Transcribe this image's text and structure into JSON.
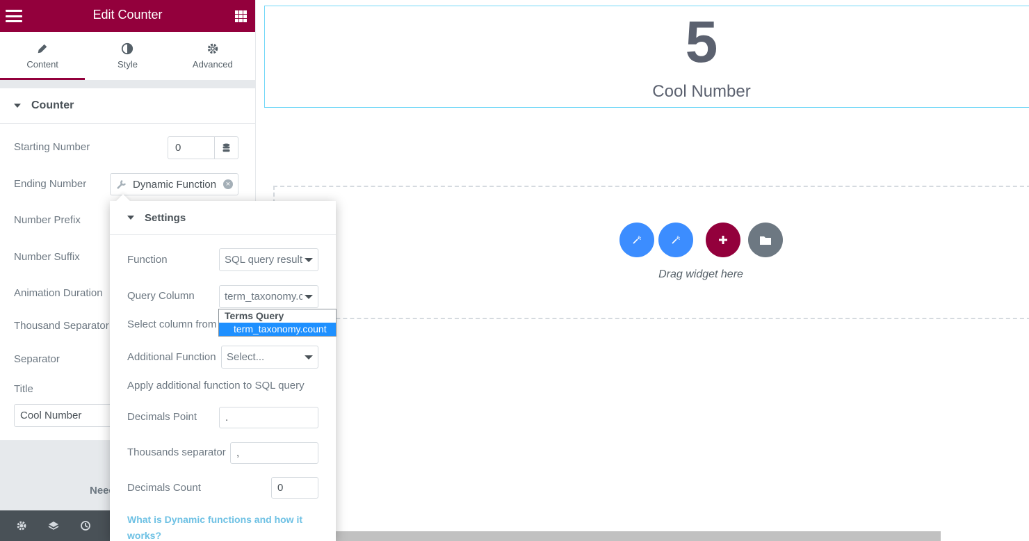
{
  "panel": {
    "title": "Edit Counter",
    "tabs": [
      {
        "label": "Content",
        "icon": "pencil-icon"
      },
      {
        "label": "Style",
        "icon": "half-circle-icon"
      },
      {
        "label": "Advanced",
        "icon": "gear-icon"
      }
    ],
    "section_title": "Counter",
    "fields": {
      "starting_number": {
        "label": "Starting Number",
        "value": "0"
      },
      "ending_number": {
        "label": "Ending Number",
        "dynamic_tag": "Dynamic Function"
      },
      "number_prefix": {
        "label": "Number Prefix"
      },
      "number_suffix": {
        "label": "Number Suffix"
      },
      "animation_duration": {
        "label": "Animation Duration"
      },
      "thousand_separator": {
        "label": "Thousand Separator"
      },
      "separator": {
        "label": "Separator"
      },
      "title": {
        "label": "Title",
        "value": "Cool Number"
      }
    },
    "need_help": "Need",
    "footer_icons": [
      "gear-icon",
      "layers-icon",
      "history-icon",
      "responsive-icon"
    ]
  },
  "popover": {
    "title": "Settings",
    "function": {
      "label": "Function",
      "selected": "SQL query result"
    },
    "query_column": {
      "label": "Query Column",
      "selected": "term_taxonomy.count",
      "help": "Select column from"
    },
    "dropdown": {
      "group": "Terms Query",
      "option": "term_taxonomy.count"
    },
    "additional_function": {
      "label": "Additional Function",
      "selected": "Select...",
      "help": "Apply additional function to SQL query"
    },
    "decimals_point": {
      "label": "Decimals Point",
      "value": "."
    },
    "thousands_separator": {
      "label": "Thousands separator",
      "value": ","
    },
    "decimals_count": {
      "label": "Decimals Count",
      "value": "0"
    },
    "help_link": "What is Dynamic functions and how it works?"
  },
  "canvas": {
    "counter_number": "5",
    "counter_title": "Cool Number",
    "drag_text": "Drag widget here"
  },
  "colors": {
    "brand": "#93003c",
    "blue_button": "#3c8dff",
    "grey_button": "#6d7882",
    "link": "#6ec1e4"
  }
}
